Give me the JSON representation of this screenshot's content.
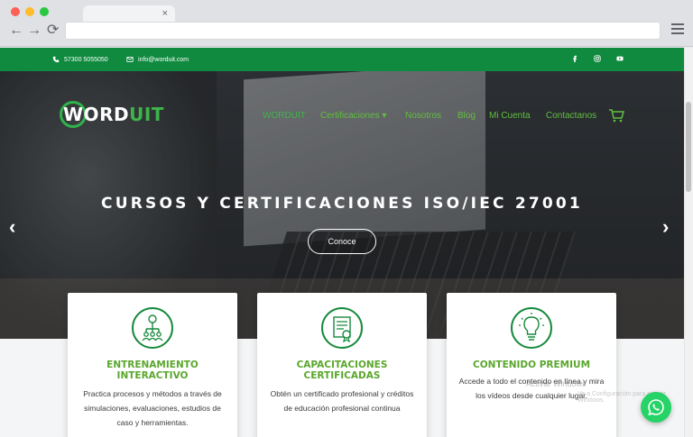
{
  "browser": {
    "tab_close": "×",
    "back_icon": "←",
    "forward_icon": "→",
    "reload_icon": "⟳",
    "address_text": ""
  },
  "topbar": {
    "phone": "57300 5055050",
    "email": "info@worduit.com",
    "social": [
      "facebook-icon",
      "instagram-icon",
      "youtube-icon"
    ],
    "bg_color": "#0f8a3f"
  },
  "logo": {
    "word": "WORD",
    "accent": "UIT"
  },
  "nav": {
    "items": [
      "WORDUIT",
      "Certificaciones ▾",
      "Nosotros",
      "Blog",
      "Mi Cuenta",
      "Contactanos"
    ],
    "accent_color": "#5fbf3f"
  },
  "hero": {
    "headline": "CURSOS Y CERTIFICACIONES ISO/IEC 27001",
    "cta": "Conoce",
    "prev_arrow": "‹",
    "next_arrow": "›"
  },
  "cards": [
    {
      "icon": "training-group-icon",
      "title": "ENTRENAMIENTO INTERACTIVO",
      "desc": "Practica procesos y métodos a través de simulaciones, evaluaciones, estudios de caso y herramientas."
    },
    {
      "icon": "certificate-icon",
      "title": "CAPACITACIONES CERTIFICADAS",
      "desc": "Obtén un certificado profesional y créditos de educación profesional continua"
    },
    {
      "icon": "lightbulb-icon",
      "title": "CONTENIDO PREMIUM",
      "desc": "Accede a todo el contenido en línea y mira los vídeos desde cualquier lugar."
    }
  ],
  "watermark": {
    "line1": "Activar Windows",
    "line2": "Ve a Configuración para activar Windows."
  },
  "whatsapp": {
    "icon": "whatsapp-icon"
  }
}
